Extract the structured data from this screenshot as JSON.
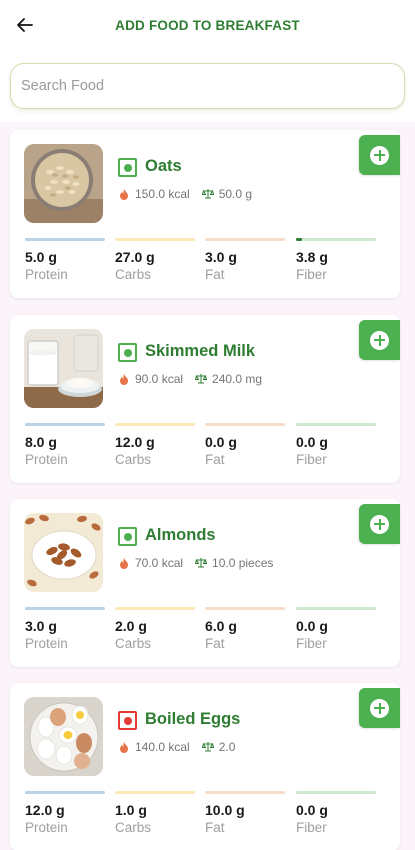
{
  "header": {
    "title": "ADD FOOD TO BREAKFAST",
    "back_icon": "arrow-left-icon"
  },
  "search": {
    "placeholder": "Search Food",
    "value": ""
  },
  "colors": {
    "brand_green": "#2e7d32",
    "add_button": "#4caf50",
    "veg": "#4caf50",
    "nonveg": "#e53935",
    "list_background": "#fbf4fb"
  },
  "foods": [
    {
      "name": "Oats",
      "type": "veg",
      "calories": "150.0 kcal",
      "quantity": "50.0 g",
      "nutrition": {
        "protein": "5.0 g",
        "carbs": "27.0 g",
        "fat": "3.0 g",
        "fiber": "3.8 g"
      }
    },
    {
      "name": "Skimmed Milk",
      "type": "veg",
      "calories": "90.0 kcal",
      "quantity": "240.0 mg",
      "nutrition": {
        "protein": "8.0 g",
        "carbs": "12.0 g",
        "fat": "0.0 g",
        "fiber": "0.0 g"
      }
    },
    {
      "name": "Almonds",
      "type": "veg",
      "calories": "70.0 kcal",
      "quantity": "10.0 pieces",
      "nutrition": {
        "protein": "3.0 g",
        "carbs": "2.0 g",
        "fat": "6.0 g",
        "fiber": "0.0 g"
      }
    },
    {
      "name": "Boiled Eggs",
      "type": "nonveg",
      "calories": "140.0 kcal",
      "quantity": "2.0",
      "nutrition": {
        "protein": "12.0 g",
        "carbs": "1.0 g",
        "fat": "10.0 g",
        "fiber": "0.0 g"
      }
    }
  ],
  "labels": {
    "protein": "Protein",
    "carbs": "Carbs",
    "fat": "Fat",
    "fiber": "Fiber"
  },
  "icons": {
    "calories": "flame-icon",
    "quantity": "scale-icon",
    "add": "plus-circle-icon"
  }
}
